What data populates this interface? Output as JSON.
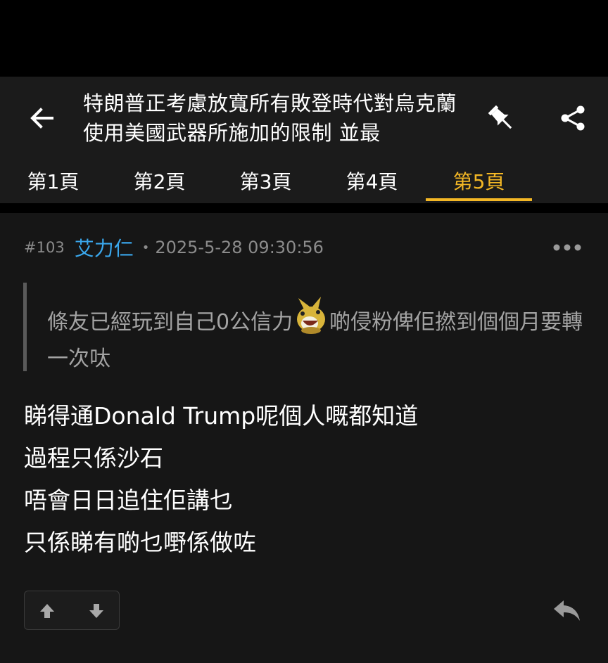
{
  "header": {
    "title": "特朗普正考慮放寬所有敗登時代對烏克蘭使用美國武器所施加的限制 並最",
    "back_icon": "arrow-left-icon",
    "pin_icon": "pushpin-icon",
    "share_icon": "share-icon"
  },
  "tabs": [
    {
      "label": "第1頁",
      "active": false
    },
    {
      "label": "第2頁",
      "active": false
    },
    {
      "label": "第3頁",
      "active": false
    },
    {
      "label": "第4頁",
      "active": false
    },
    {
      "label": "第5頁",
      "active": true
    }
  ],
  "post": {
    "floor": "#103",
    "username": "艾力仁",
    "separator": "•",
    "timestamp": "2025-5-28 09:30:56",
    "quote": {
      "before_emoji": "條友已經玩到自己0公信力",
      "emoji": "laughing-creature-emoji",
      "after_emoji": "啲侵粉俾佢撚到個個月要轉一次呔"
    },
    "body_lines": [
      "睇得通Donald Trump呢個人嘅都知道",
      "過程只係沙石",
      "唔會日日追住佢講乜",
      "只係睇有啲乜嘢係做咗"
    ]
  },
  "colors": {
    "accent": "#f3b725",
    "username": "#3aa7ec",
    "header_bg": "#1b1b1b",
    "post_bg": "#161616"
  }
}
